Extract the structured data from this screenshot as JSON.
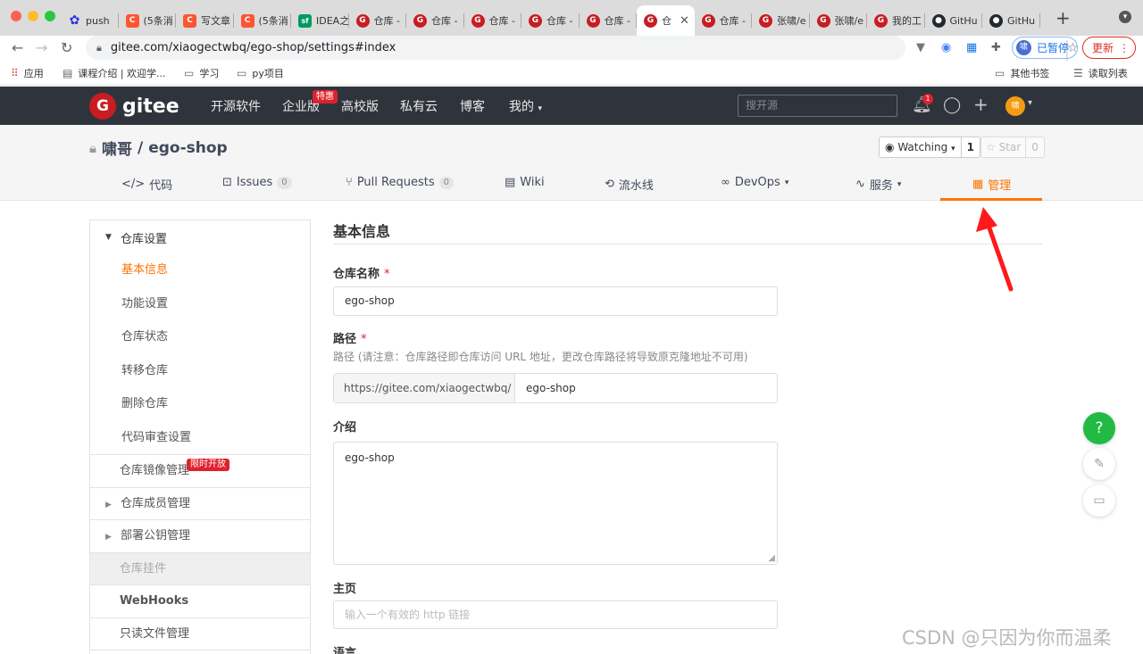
{
  "browser": {
    "tabs": [
      {
        "icon": "baidu",
        "label": "push"
      },
      {
        "icon": "csdn",
        "label": "(5条消"
      },
      {
        "icon": "csdn",
        "label": "写文章"
      },
      {
        "icon": "csdn",
        "label": "(5条消"
      },
      {
        "icon": "sf",
        "label": "IDEA之"
      },
      {
        "icon": "gitee",
        "label": "仓库 -"
      },
      {
        "icon": "gitee",
        "label": "仓库 -"
      },
      {
        "icon": "gitee",
        "label": "仓库 -"
      },
      {
        "icon": "gitee",
        "label": "仓库 -"
      },
      {
        "icon": "gitee",
        "label": "仓库 -"
      },
      {
        "icon": "gitee",
        "label": "仓",
        "active": true
      },
      {
        "icon": "gitee",
        "label": "仓库 -"
      },
      {
        "icon": "gitee",
        "label": "张啸/e"
      },
      {
        "icon": "gitee",
        "label": "张啸/e"
      },
      {
        "icon": "gitee",
        "label": "我的工"
      },
      {
        "icon": "github",
        "label": "GitHu"
      },
      {
        "icon": "github",
        "label": "GitHu"
      }
    ],
    "url": "gitee.com/xiaogectwbq/ego-shop/settings#index",
    "profile_label": "已暂停",
    "profile_avatar": "啸",
    "update_label": "更新",
    "bookmarks": {
      "apps": "应用",
      "course": "课程介绍 | 欢迎学...",
      "study": "学习",
      "py": "py项目",
      "other": "其他书签",
      "reading": "读取列表"
    }
  },
  "gitee": {
    "logo_text": "gitee",
    "logo_letter": "G",
    "nav": [
      "开源软件",
      "企业版",
      "高校版",
      "私有云",
      "博客",
      "我的"
    ],
    "hot_badge": "特惠",
    "search_placeholder": "搜开源",
    "notif_count": "1",
    "avatar_text": "啸"
  },
  "repo": {
    "owner": "啸哥",
    "separator": "/",
    "name": "ego-shop",
    "watch_label": "Watching",
    "watch_count": "1",
    "star_label": "Star",
    "star_count": "0",
    "tabs": [
      {
        "label": "代码",
        "icon": "code"
      },
      {
        "label": "Issues",
        "count": "0",
        "icon": "issues"
      },
      {
        "label": "Pull Requests",
        "count": "0",
        "icon": "pr"
      },
      {
        "label": "Wiki",
        "icon": "wiki"
      },
      {
        "label": "流水线",
        "icon": "pipeline"
      },
      {
        "label": "DevOps",
        "icon": "devops"
      },
      {
        "label": "服务",
        "icon": "service"
      },
      {
        "label": "管理",
        "icon": "manage",
        "active": true
      }
    ]
  },
  "sidebar": {
    "group_title": "仓库设置",
    "sub_items": [
      "基本信息",
      "功能设置",
      "仓库状态",
      "转移仓库",
      "删除仓库",
      "代码审查设置"
    ],
    "mirror": "仓库镜像管理",
    "limited_badge": "限时开放",
    "members": "仓库成员管理",
    "deploy_keys": "部署公钥管理",
    "hooks": "仓库挂件",
    "webhooks": "WebHooks",
    "readonly": "只读文件管理"
  },
  "form": {
    "title": "基本信息",
    "name_label": "仓库名称",
    "name_value": "ego-shop",
    "path_label": "路径",
    "path_hint": "路径 (请注意：仓库路径即仓库访问 URL 地址，更改仓库路径将导致原克隆地址不可用)",
    "path_prefix": "https://gitee.com/xiaogectwbq/",
    "path_value": "ego-shop",
    "intro_label": "介绍",
    "intro_value": "ego-shop",
    "homepage_label": "主页",
    "homepage_placeholder": "输入一个有效的 http 链接",
    "language_label": "语言",
    "required_mark": "*"
  },
  "float": {
    "help": "?"
  },
  "watermark": "CSDN @只因为你而温柔",
  "colors": {
    "accent": "#fe7300",
    "gitee_red": "#c71d23",
    "header_bg": "#2f343c",
    "help_green": "#21ba45"
  }
}
